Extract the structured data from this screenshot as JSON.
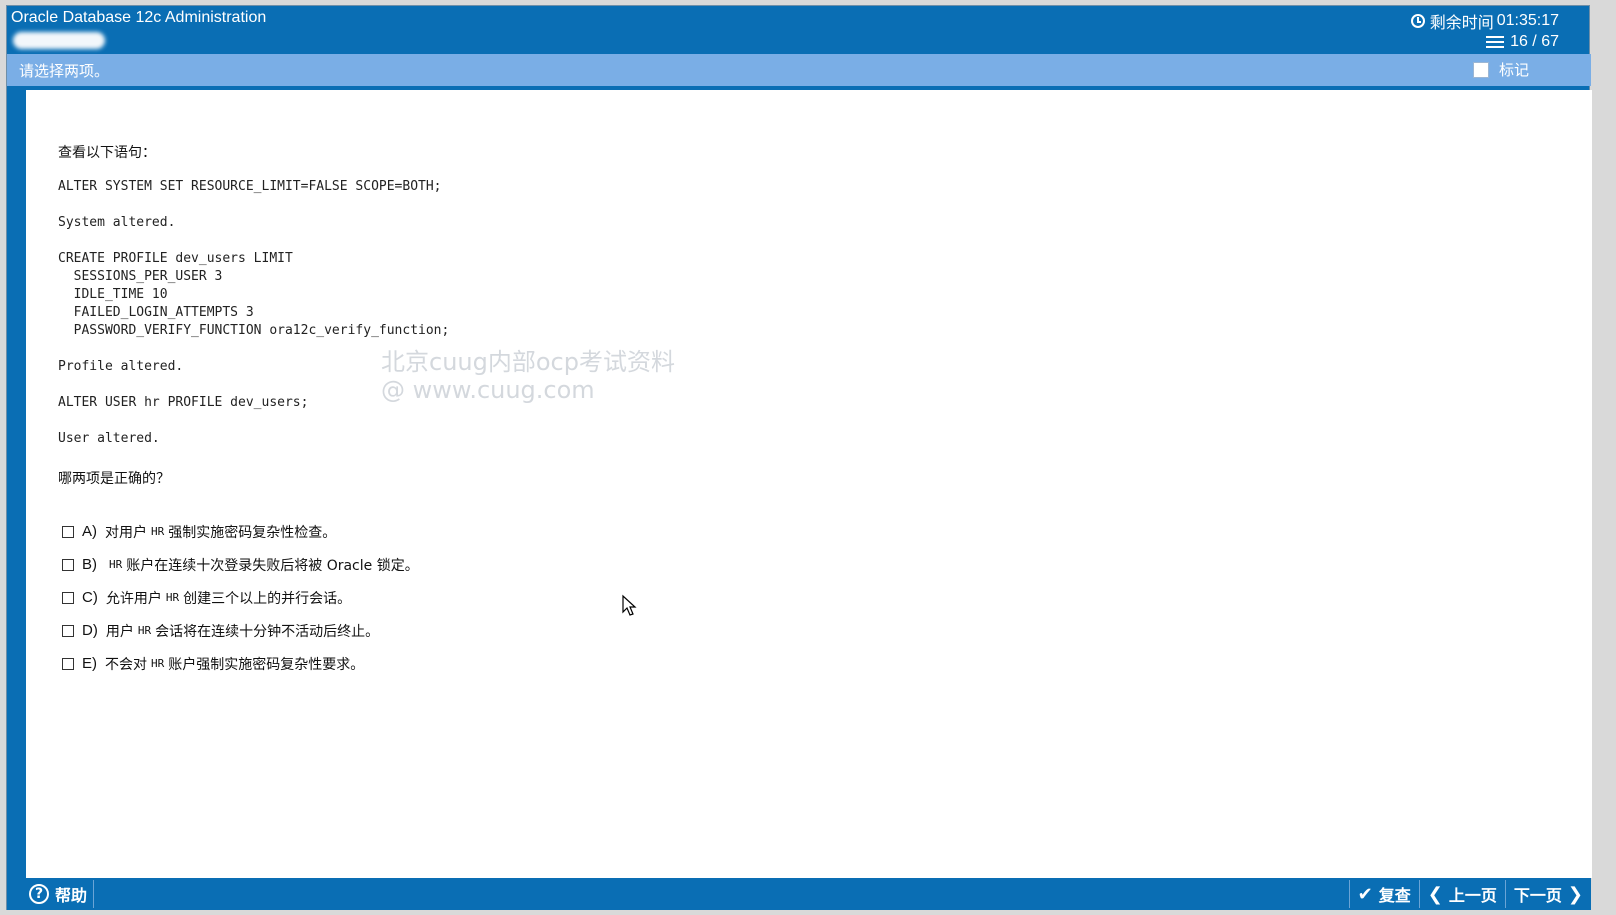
{
  "header": {
    "app_title": "Oracle Database 12c Administration",
    "time_label": "剩余时间",
    "time_remaining": "01:35:17",
    "question_counter": "16 / 67"
  },
  "instruction": {
    "text": "请选择两项。",
    "mark_label": "标记"
  },
  "question": {
    "prompt": "查看以下语句：",
    "code": "ALTER SYSTEM SET RESOURCE_LIMIT=FALSE SCOPE=BOTH;\n\nSystem altered.\n\nCREATE PROFILE dev_users LIMIT\n  SESSIONS_PER_USER 3\n  IDLE_TIME 10\n  FAILED_LOGIN_ATTEMPTS 3\n  PASSWORD_VERIFY_FUNCTION ora12c_verify_function;\n\nProfile altered.\n\nALTER USER hr PROFILE dev_users;\n\nUser altered.",
    "question_text": "哪两项是正确的？",
    "options": [
      {
        "letter": "A)",
        "pre": "对用户",
        "code": "HR",
        "post": "强制实施密码复杂性检查。"
      },
      {
        "letter": "B)",
        "pre": "",
        "code": "HR",
        "post": "账户在连续十次登录失败后将被 Oracle 锁定。"
      },
      {
        "letter": "C)",
        "pre": "允许用户",
        "code": "HR",
        "post": "创建三个以上的并行会话。"
      },
      {
        "letter": "D)",
        "pre": "用户",
        "code": "HR",
        "post": "会话将在连续十分钟不活动后终止。"
      },
      {
        "letter": "E)",
        "pre": "不会对",
        "code": "HR",
        "post": "账户强制实施密码复杂性要求。"
      }
    ]
  },
  "watermark": {
    "line1": "北京cuug内部ocp考试资料",
    "line2": "@ www.cuug.com"
  },
  "footer": {
    "help_label": "帮助",
    "review_label": "复查",
    "prev_label": "上一页",
    "next_label": "下一页"
  },
  "icons": {
    "clock": "clock-icon",
    "counter": "stack-icon",
    "help": "help-icon",
    "review": "check-icon",
    "prev": "arrow-left-icon",
    "next": "arrow-right-icon"
  }
}
